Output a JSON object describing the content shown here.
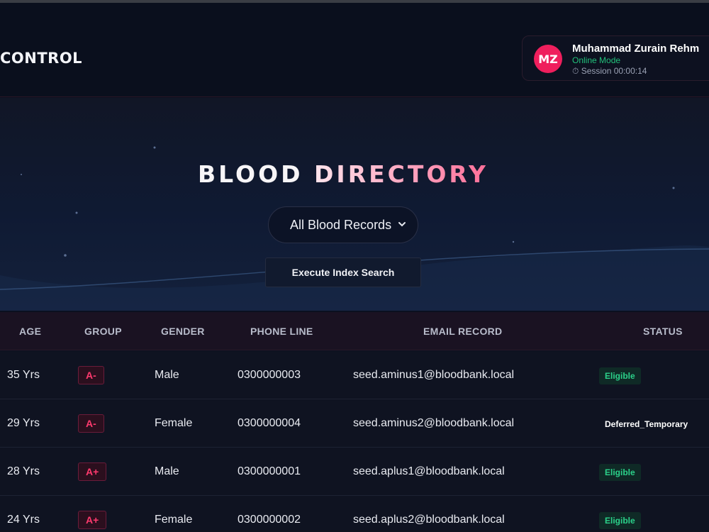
{
  "brand": {
    "title": "CONTROL"
  },
  "user": {
    "initials": "MZ",
    "name": "Muhammad Zurain Rehm",
    "mode": "Online Mode",
    "session": "⏱ Session 00:00:14"
  },
  "hero": {
    "title_part1": "BLOOD ",
    "title_part2": "DIRECTORY",
    "filter_selected": "All Blood Records",
    "search_button": "Execute Index Search"
  },
  "table": {
    "headers": [
      "AGE",
      "GROUP",
      "GENDER",
      "PHONE LINE",
      "EMAIL RECORD",
      "STATUS"
    ],
    "rows": [
      {
        "age": "35 Yrs",
        "group": "A-",
        "gender": "Male",
        "phone": "0300000003",
        "email": "seed.aminus1@bloodbank.local",
        "status": "Eligible"
      },
      {
        "age": "29 Yrs",
        "group": "A-",
        "gender": "Female",
        "phone": "0300000004",
        "email": "seed.aminus2@bloodbank.local",
        "status": "Deferred_Temporary"
      },
      {
        "age": "28 Yrs",
        "group": "A+",
        "gender": "Male",
        "phone": "0300000001",
        "email": "seed.aplus1@bloodbank.local",
        "status": "Eligible"
      },
      {
        "age": "24 Yrs",
        "group": "A+",
        "gender": "Female",
        "phone": "0300000002",
        "email": "seed.aplus2@bloodbank.local",
        "status": "Eligible"
      }
    ]
  },
  "colors": {
    "accent": "#ef1f5d",
    "eligible": "#2bd18a",
    "background": "#0b1020"
  }
}
